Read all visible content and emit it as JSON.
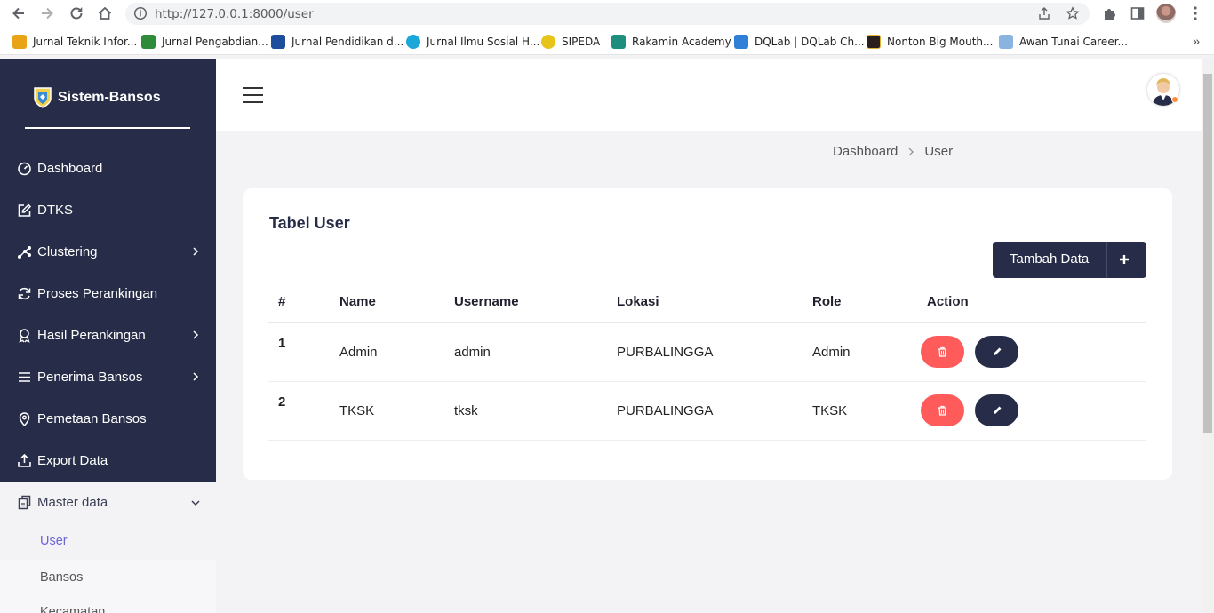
{
  "browser": {
    "url": "http://127.0.0.1:8000/user",
    "bookmarks": [
      {
        "label": "Jurnal Teknik Infor...",
        "color": "#e8a317"
      },
      {
        "label": "Jurnal Pengabdian...",
        "color": "#2e8b3a"
      },
      {
        "label": "Jurnal Pendidikan d...",
        "color": "#1e4d9b"
      },
      {
        "label": "Jurnal Ilmu Sosial H...",
        "color": "#1aa7d9"
      },
      {
        "label": "SIPEDA",
        "color": "#e6c419"
      },
      {
        "label": "Rakamin Academy",
        "color": "#1e8f7d"
      },
      {
        "label": "DQLab | DQLab Ch...",
        "color": "#2f7fd6"
      },
      {
        "label": "Nonton Big Mouth...",
        "color": "#2a1e1e"
      },
      {
        "label": "Awan Tunai Career...",
        "color": "#8ab4e0"
      }
    ],
    "more": "»"
  },
  "sidebar": {
    "brand": "Sistem-Bansos",
    "items": [
      {
        "label": "Dashboard",
        "icon": "gauge-icon"
      },
      {
        "label": "DTKS",
        "icon": "edit-icon"
      },
      {
        "label": "Clustering",
        "icon": "cluster-icon",
        "chevron": true
      },
      {
        "label": "Proses Perankingan",
        "icon": "refresh-icon"
      },
      {
        "label": "Hasil Perankingan",
        "icon": "award-icon",
        "chevron": true
      },
      {
        "label": "Penerima Bansos",
        "icon": "list-icon",
        "chevron": true
      },
      {
        "label": "Pemetaan Bansos",
        "icon": "map-pin-icon"
      },
      {
        "label": "Export Data",
        "icon": "upload-icon"
      }
    ],
    "master": {
      "label": "Master data",
      "sub": [
        {
          "label": "User",
          "active": true
        },
        {
          "label": "Bansos"
        },
        {
          "label": "Kecamatan"
        }
      ]
    }
  },
  "header": {
    "breadcrumb": [
      "Dashboard",
      "User"
    ]
  },
  "card": {
    "title": "Tabel User",
    "add_button": "Tambah Data",
    "columns": [
      "#",
      "Name",
      "Username",
      "Lokasi",
      "Role",
      "Action"
    ],
    "rows": [
      {
        "no": "1",
        "name": "Admin",
        "username": "admin",
        "lokasi": "PURBALINGGA",
        "role": "Admin"
      },
      {
        "no": "2",
        "name": "TKSK",
        "username": "tksk",
        "lokasi": "PURBALINGGA",
        "role": "TKSK"
      }
    ]
  },
  "colors": {
    "sidebar_bg": "#272d48",
    "accent": "#6c63d9",
    "delete": "#ff5b5b",
    "edit": "#272d48"
  }
}
